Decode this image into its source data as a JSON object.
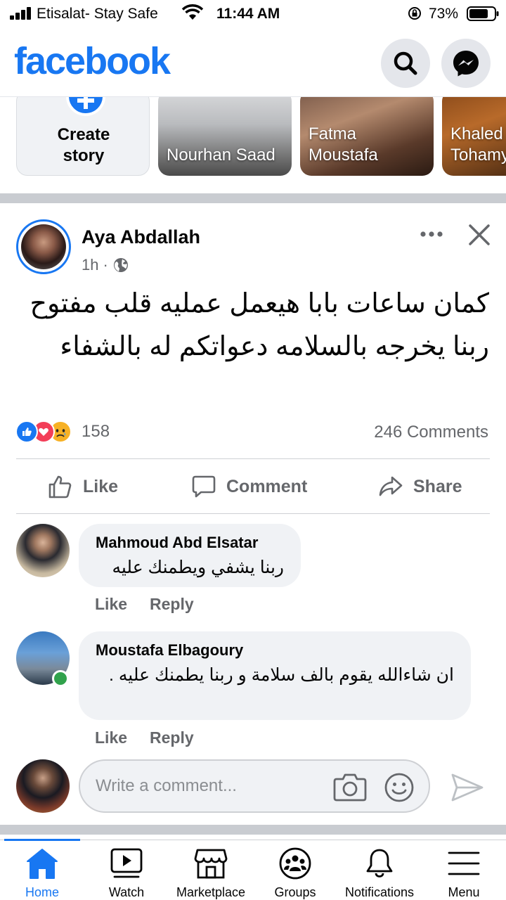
{
  "status_bar": {
    "carrier": "Etisalat- Stay Safe",
    "time": "11:44 AM",
    "battery": "73%"
  },
  "header": {
    "logo": "facebook",
    "search_icon": "search-icon",
    "messenger_icon": "messenger-icon"
  },
  "stories": {
    "create_label_line1": "Create",
    "create_label_line2": "story",
    "items": [
      {
        "name": "Nourhan Saad"
      },
      {
        "name_line1": "Fatma",
        "name_line2": "Moustafa"
      },
      {
        "name_line1": "Khaled",
        "name_line2": "Tohamy"
      }
    ]
  },
  "post": {
    "author": "Aya Abdallah",
    "time": "1h",
    "separator": "·",
    "privacy_icon": "globe-icon",
    "text": "كمان ساعات بابا هيعمل عمليه قلب مفتوح ربنا يخرجه بالسلامه دعواتكم له بالشفاء",
    "reaction_count": "158",
    "comments_count": "246 Comments",
    "actions": {
      "like": "Like",
      "comment": "Comment",
      "share": "Share"
    }
  },
  "comments": [
    {
      "author": "Mahmoud Abd Elsatar",
      "text": "ربنا يشفي ويطمنك عليه",
      "like": "Like",
      "reply": "Reply"
    },
    {
      "author": "Moustafa Elbagoury",
      "text": "ان شاءالله يقوم بالف سلامة و ربنا يطمنك عليه .",
      "like": "Like",
      "reply": "Reply"
    }
  ],
  "composer": {
    "placeholder": "Write a comment..."
  },
  "tabs": [
    {
      "label": "Home",
      "icon": "home-icon",
      "active": true
    },
    {
      "label": "Watch",
      "icon": "watch-icon"
    },
    {
      "label": "Marketplace",
      "icon": "marketplace-icon"
    },
    {
      "label": "Groups",
      "icon": "groups-icon"
    },
    {
      "label": "Notifications",
      "icon": "bell-icon"
    },
    {
      "label": "Menu",
      "icon": "menu-icon"
    }
  ],
  "colors": {
    "brand": "#1877f2",
    "secondary_text": "#65676b",
    "online": "#31a24c"
  }
}
